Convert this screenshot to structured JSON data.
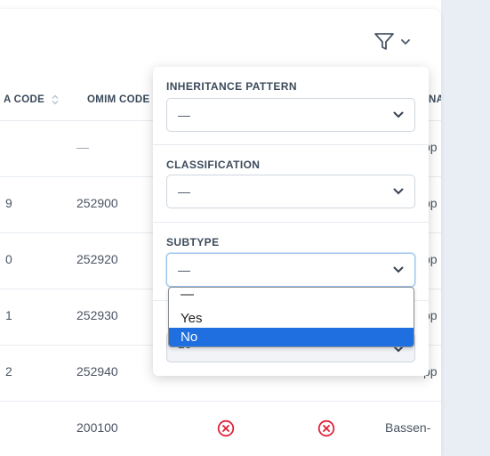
{
  "table": {
    "columns": [
      {
        "label": "A CODE"
      },
      {
        "label": "OMIM CODE"
      },
      {
        "label": "NA"
      }
    ],
    "rows": [
      {
        "code_tail": "",
        "omim": "—",
        "name": "pp"
      },
      {
        "code_tail": "9",
        "omim": "252900",
        "name": "pp"
      },
      {
        "code_tail": "0",
        "omim": "252920",
        "name": "pp"
      },
      {
        "code_tail": "1",
        "omim": "252930",
        "name": "pp"
      },
      {
        "code_tail": "2",
        "omim": "252940",
        "name": "pp"
      },
      {
        "code_tail": "",
        "omim": "200100",
        "name": "Bassen-"
      }
    ],
    "status_icon_color": "#e0223a"
  },
  "filter": {
    "icon": "filter-icon",
    "sections": [
      {
        "label": "INHERITANCE PATTERN",
        "value": "—"
      },
      {
        "label": "CLASSIFICATION",
        "value": "—"
      },
      {
        "label": "SUBTYPE",
        "value": "—"
      },
      {
        "behind_value": "25"
      }
    ],
    "subtype_options": [
      "—",
      "Yes",
      "No"
    ],
    "selected_option": "No"
  },
  "colors": {
    "accent": "#1f6fe0",
    "focus_border": "#9cc4ee",
    "gutter": "#e9eef4"
  }
}
